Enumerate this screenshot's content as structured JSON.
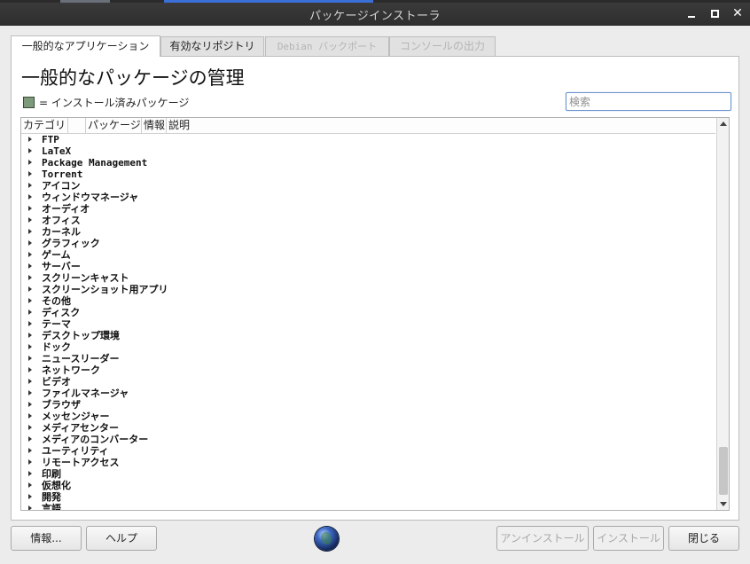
{
  "window": {
    "title": "パッケージインストーラ",
    "minimize_icon": "minimize-icon",
    "maximize_icon": "maximize-icon",
    "close_glyph": "✕"
  },
  "tabs": [
    {
      "label": "一般的なアプリケーション",
      "active": true,
      "enabled": true
    },
    {
      "label": "有効なリポジトリ",
      "active": false,
      "enabled": true
    },
    {
      "label": "Debian バックポート",
      "active": false,
      "enabled": false
    },
    {
      "label": "コンソールの出力",
      "active": false,
      "enabled": false
    }
  ],
  "main": {
    "heading": "一般的なパッケージの管理",
    "legend_text": "= インストール済みパッケージ",
    "legend_color": "#7d9a7a",
    "search_placeholder": "検索"
  },
  "tree": {
    "columns": [
      "カテゴリ",
      "",
      "パッケージ",
      "情報",
      "説明"
    ],
    "categories": [
      "FTP",
      "LaTeX",
      "Package Management",
      "Torrent",
      "アイコン",
      "ウィンドウマネージャ",
      "オーディオ",
      "オフィス",
      "カーネル",
      "グラフィック",
      "ゲーム",
      "サーバー",
      "スクリーンキャスト",
      "スクリーンショット用アプリ",
      "その他",
      "ディスク",
      "テーマ",
      "デスクトップ環境",
      "ドック",
      "ニュースリーダー",
      "ネットワーク",
      "ビデオ",
      "ファイルマネージャ",
      "ブラウザ",
      "メッセンジャー",
      "メディアセンター",
      "メディアのコンバーター",
      "ユーティリティ",
      "リモートアクセス",
      "印刷",
      "仮想化",
      "開発",
      "言語"
    ]
  },
  "buttons": {
    "info": "情報...",
    "help": "ヘルプ",
    "uninstall": "アンインストール",
    "install": "インストール",
    "close": "閉じる"
  }
}
